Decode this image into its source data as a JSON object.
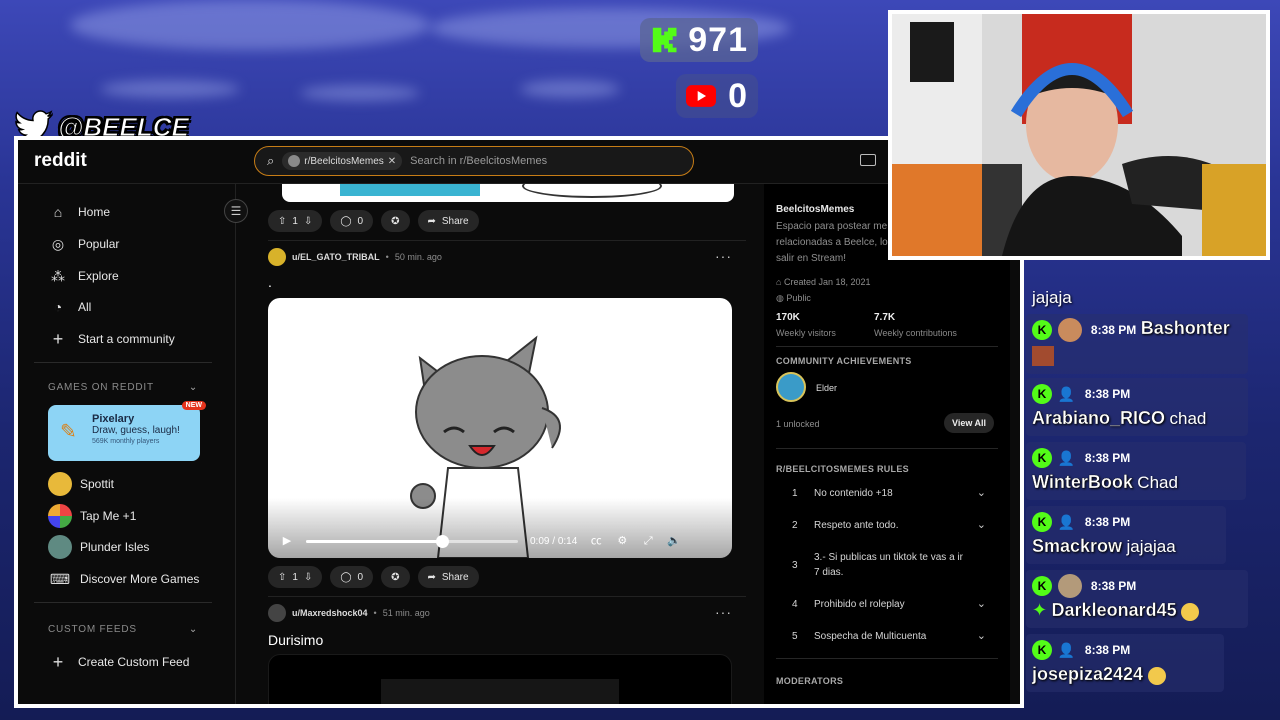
{
  "overlay": {
    "kick_count": "971",
    "youtube_count": "0",
    "twitter_handle": "@BEELCE_"
  },
  "topbar": {
    "logo": "reddit",
    "search_chip": "r/BeelcitosMemes",
    "search_placeholder": "Search in r/BeelcitosMemes"
  },
  "sidebar": {
    "nav": [
      {
        "label": "Home",
        "icon": "home-icon"
      },
      {
        "label": "Popular",
        "icon": "popular-icon"
      },
      {
        "label": "Explore",
        "icon": "explore-icon"
      },
      {
        "label": "All",
        "icon": "all-icon"
      },
      {
        "label": "Start a community",
        "icon": "plus-icon"
      }
    ],
    "games_header": "GAMES ON REDDIT",
    "featured_game": {
      "title": "Pixelary",
      "subtitle": "Draw, guess, laugh!",
      "players": "569K monthly players",
      "badge": "NEW"
    },
    "games": [
      "Spottit",
      "Tap Me +1",
      "Plunder Isles",
      "Discover More Games"
    ],
    "custom_feeds_header": "CUSTOM FEEDS",
    "create_feed": "Create Custom Feed"
  },
  "posts": [
    {
      "votes": "1",
      "comments": "0",
      "share": "Share"
    },
    {
      "user": "u/EL_GATO_TRIBAL",
      "time": "50 min. ago",
      "title": ".",
      "votes": "1",
      "comments": "0",
      "share": "Share",
      "video": {
        "current": "0:09",
        "duration": "0:14",
        "progress": 0.64
      }
    },
    {
      "user": "u/Maxredshock04",
      "time": "51 min. ago",
      "title": "Durisimo"
    }
  ],
  "community": {
    "name": "BeelcitosMemes",
    "description": [
      "Espacio para postear me",
      "relacionadas a Beelce, lo",
      "salir en Stream!"
    ],
    "created": "Created Jan 18, 2021",
    "visibility": "Public",
    "visitors": "170K",
    "visitors_label": "Weekly visitors",
    "contributions": "7.7K",
    "contributions_label": "Weekly contributions",
    "achievements_header": "COMMUNITY ACHIEVEMENTS",
    "achievement": "Elder",
    "unlocked": "1 unlocked",
    "view_all": "View All",
    "rules_header": "R/BEELCITOSMEMES RULES",
    "rules": [
      {
        "n": "1",
        "text": "No contenido +18"
      },
      {
        "n": "2",
        "text": "Respeto ante todo."
      },
      {
        "n": "3",
        "text": "3.- Si publicas un tiktok te vas a ir 7 dias."
      },
      {
        "n": "4",
        "text": "Prohibido el roleplay"
      },
      {
        "n": "5",
        "text": "Sospecha de Multicuenta"
      }
    ],
    "moderators_header": "MODERATORS"
  },
  "chat": {
    "top_text": "jajaja",
    "messages": [
      {
        "time": "8:38 PM",
        "user": "Bashonter",
        "text": ""
      },
      {
        "time": "8:38 PM",
        "user": "Arabiano_RICO",
        "text": "chad"
      },
      {
        "time": "8:38 PM",
        "user": "WinterBook",
        "text": "Chad"
      },
      {
        "time": "8:38 PM",
        "user": "Smackrow",
        "text": "jajajaa"
      },
      {
        "time": "8:38 PM",
        "user": "Darkleonard45",
        "text": ""
      },
      {
        "time": "8:38 PM",
        "user": "josepiza2424",
        "text": ""
      }
    ]
  },
  "colors": {
    "kick_green": "#53fc18",
    "youtube_red": "#ff0000",
    "search_border": "#c77d16"
  }
}
